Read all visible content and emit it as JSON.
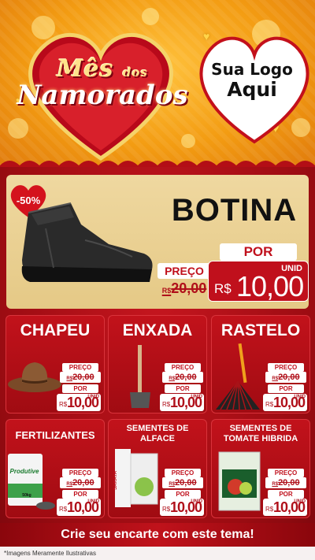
{
  "header": {
    "title_line1": "Mês",
    "title_small": "dos",
    "title_line2": "Namorados",
    "logo_line1": "Sua Logo",
    "logo_line2": "Aqui"
  },
  "featured": {
    "discount": "-50%",
    "name": "BOTINA",
    "por": "POR",
    "preco": "PREÇO",
    "currency_old": "R$",
    "old_price": "20,00",
    "currency": "R$",
    "price": "10,00",
    "unit": "UNID"
  },
  "price_labels": {
    "preco": "PREÇO",
    "por": "POR",
    "currency": "R$",
    "old_price": "20,00",
    "price": "10,00",
    "unit": "UNID"
  },
  "products": [
    {
      "name": "CHAPEU"
    },
    {
      "name": "ENXADA"
    },
    {
      "name": "RASTELO"
    },
    {
      "name": "FERTILIZANTES",
      "pack_brand": "Produtive",
      "pack_weight": "50kg"
    },
    {
      "name_line1": "SEMENTES DE",
      "name_line2": "ALFACE",
      "pack_brand": "SAKATA"
    },
    {
      "name_line1": "SEMENTES DE",
      "name_line2": "TOMATE HIBRIDA"
    }
  ],
  "cta": "Crie seu encarte com este tema!",
  "footer": "*Imagens Meramente Ilustrativas",
  "colors": {
    "header_orange": "#f39c12",
    "brand_red": "#c0101c",
    "card_cream": "#efd8a0"
  }
}
